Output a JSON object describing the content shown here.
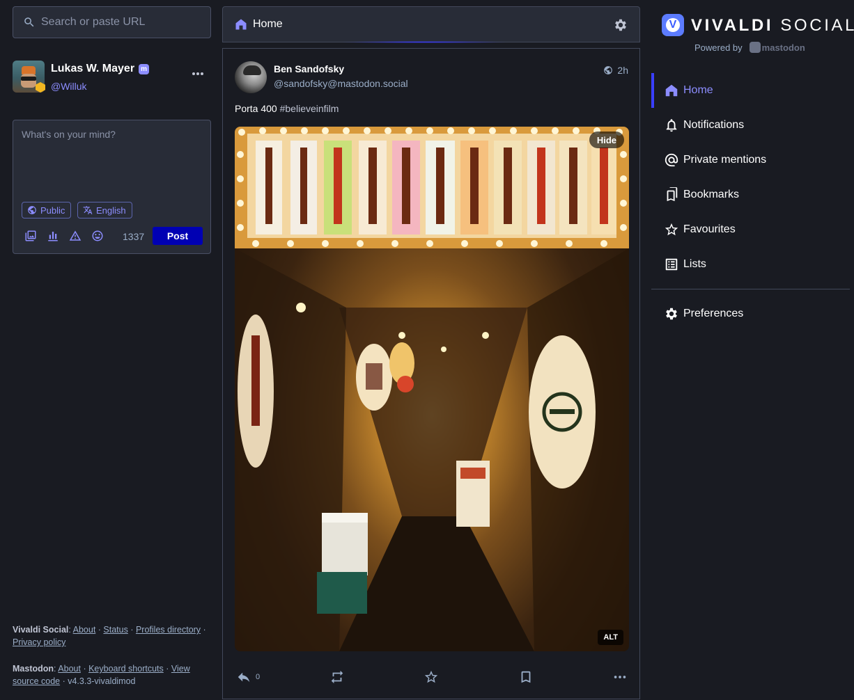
{
  "search": {
    "placeholder": "Search or paste URL"
  },
  "profile": {
    "name": "Lukas W. Mayer",
    "badge": "m",
    "handle": "@Willuk"
  },
  "composer": {
    "placeholder": "What's on your mind?",
    "visibility": "Public",
    "language": "English",
    "char_count": "1337",
    "post_label": "Post"
  },
  "footer": {
    "site_name": "Vivaldi Social",
    "links": [
      "About",
      "Status",
      "Profiles directory",
      "Privacy policy"
    ],
    "mastodon_name": "Mastodon",
    "mastodon_links": [
      "About",
      "Keyboard shortcuts",
      "View source code"
    ],
    "version": "v4.3.3-vivaldimod"
  },
  "column": {
    "title": "Home"
  },
  "status": {
    "author": "Ben Sandofsky",
    "handle": "@sandofsky@mastodon.social",
    "time": "2h",
    "text_plain": "Porta 400 ",
    "hashtag": "#believeinfilm",
    "media_hide": "Hide",
    "media_alt": "ALT",
    "replies": "0"
  },
  "brand": {
    "word1": "VIVALDI",
    "word2": "SOCIAL",
    "powered": "Powered by",
    "powered_by": "mastodon"
  },
  "nav": {
    "items": [
      {
        "label": "Home",
        "icon": "home-icon",
        "active": true
      },
      {
        "label": "Notifications",
        "icon": "bell-icon"
      },
      {
        "label": "Private mentions",
        "icon": "at-icon"
      },
      {
        "label": "Bookmarks",
        "icon": "bookmarks-icon"
      },
      {
        "label": "Favourites",
        "icon": "star-icon"
      },
      {
        "label": "Lists",
        "icon": "list-icon"
      }
    ],
    "preferences": "Preferences"
  },
  "colors": {
    "accent": "#8c8dff",
    "primary_button": "#0000b3",
    "background": "#191b22",
    "panel": "#282c37"
  }
}
